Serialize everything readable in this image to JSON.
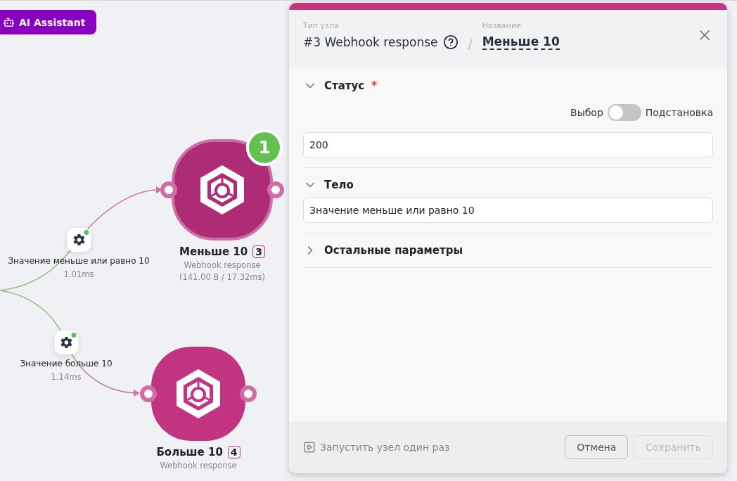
{
  "ai_button": {
    "label": "AI Assistant"
  },
  "canvas": {
    "conditions": [
      {
        "label": "Значение меньше или равно 10",
        "time": "1.01ms",
        "active": true
      },
      {
        "label": "Значение больше 10",
        "time": "1.14ms",
        "active": true
      }
    ],
    "nodes": [
      {
        "title": "Меньше 10",
        "index": "3",
        "type": "Webhook response",
        "stats": "(141.00 B / 17.32ms)",
        "selected": true,
        "badge": "1"
      },
      {
        "title": "Больше 10",
        "index": "4",
        "type": "Webhook response",
        "selected": false
      }
    ]
  },
  "panel": {
    "type_label": "Тип узла",
    "type_value": "#3 Webhook response",
    "separator": "/",
    "name_label": "Название",
    "name_value": "Меньше 10",
    "sections": [
      {
        "title": "Статус",
        "required_mark": "*",
        "expanded": true,
        "toggle": {
          "left": "Выбор",
          "right": "Подстановка",
          "on": false
        },
        "value": "200"
      },
      {
        "title": "Тело",
        "expanded": true,
        "value": "Значение меньше или равно 10"
      },
      {
        "title": "Остальные параметры",
        "expanded": false
      }
    ],
    "run_once": "Запустить узел один раз",
    "cancel": {
      "label": "Отмена",
      "disabled": false
    },
    "save": {
      "label": "Сохранить",
      "disabled": true
    }
  }
}
